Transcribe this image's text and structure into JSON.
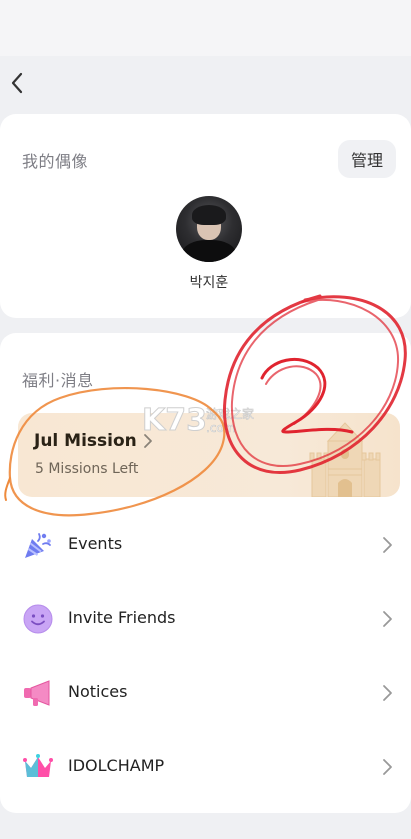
{
  "header": {
    "back_icon": "chevron-left-icon"
  },
  "idol_section": {
    "title": "我的偶像",
    "manage_label": "管理",
    "idol_name": "박지훈"
  },
  "welfare_section": {
    "title": "福利·消息",
    "mission": {
      "title": "Jul Mission",
      "subtitle": "5 Missions Left"
    },
    "items": [
      {
        "label": "Events",
        "icon": "party-popper-icon"
      },
      {
        "label": "Invite Friends",
        "icon": "smiley-icon"
      },
      {
        "label": "Notices",
        "icon": "megaphone-icon"
      },
      {
        "label": "IDOLCHAMP",
        "icon": "crown-icon"
      }
    ]
  },
  "watermark": {
    "brand": "K73",
    "cn": "游戏之家",
    "domain": ".com"
  },
  "annotation_text": "2",
  "colors": {
    "background": "#eff0f3",
    "card": "#ffffff",
    "mission_banner": "#f8e7d3",
    "red_marker": "#e0242f",
    "orange_marker": "#ee8a3c"
  }
}
